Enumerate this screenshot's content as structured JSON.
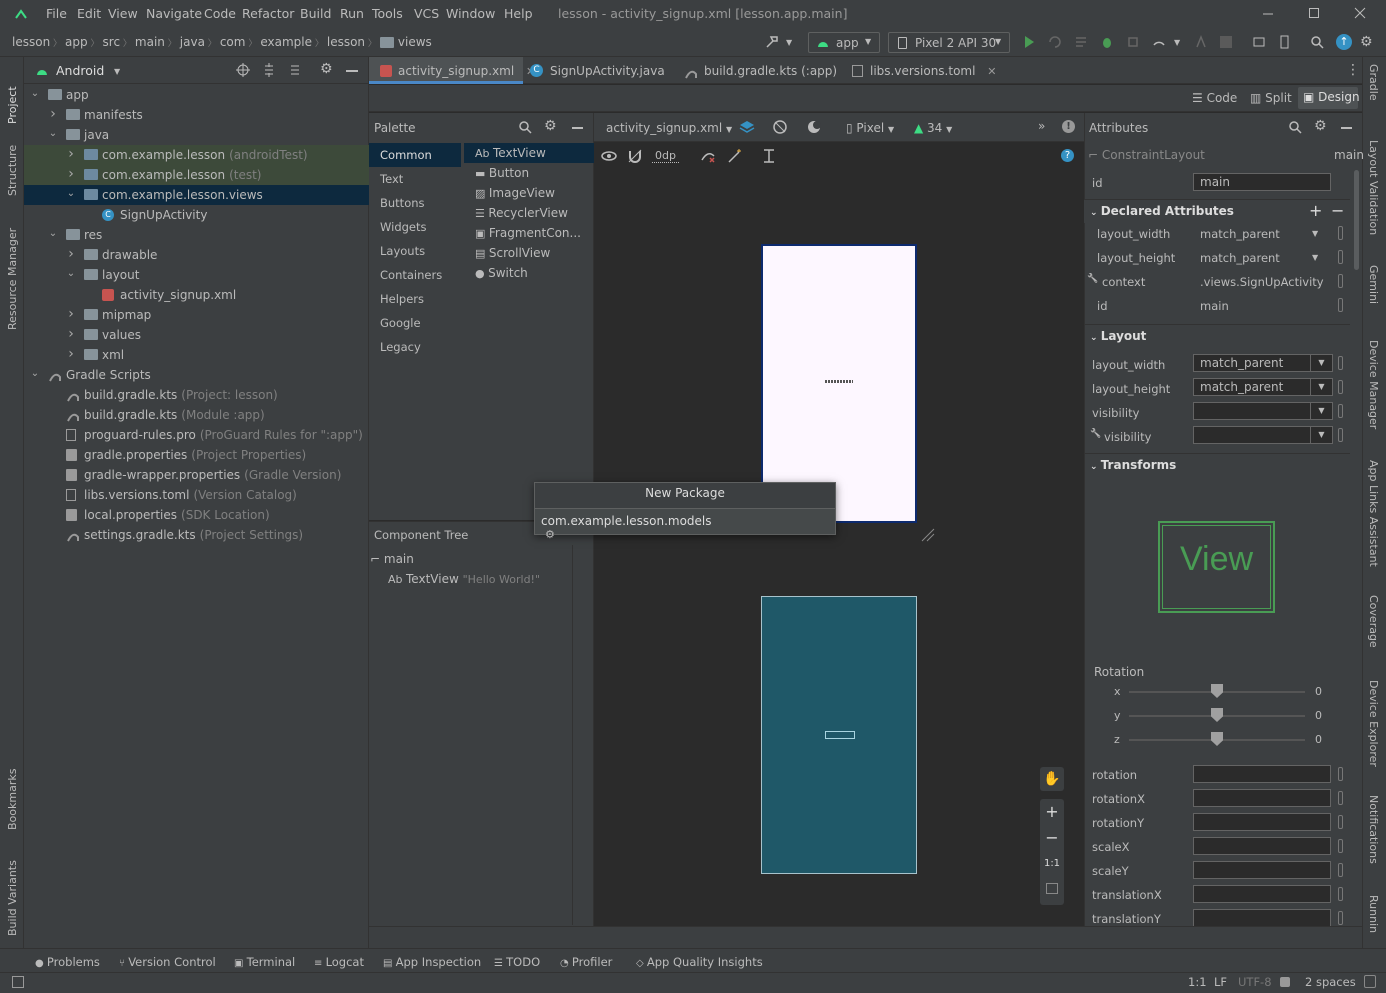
{
  "menu": {
    "items": [
      "File",
      "Edit",
      "View",
      "Navigate",
      "Code",
      "Refactor",
      "Build",
      "Run",
      "Tools",
      "VCS",
      "Window",
      "Help"
    ],
    "window_title": "lesson - activity_signup.xml [lesson.app.main]"
  },
  "breadcrumb": [
    "lesson",
    "app",
    "src",
    "main",
    "java",
    "com",
    "example",
    "lesson",
    "views"
  ],
  "toolbar": {
    "run_config": "app",
    "device": "Pixel 2 API 30"
  },
  "project_panel": {
    "title": "Android",
    "tree": [
      {
        "label": "app",
        "hint": ""
      },
      {
        "label": "manifests",
        "hint": ""
      },
      {
        "label": "java",
        "hint": ""
      },
      {
        "label": "com.example.lesson",
        "hint": "(androidTest)"
      },
      {
        "label": "com.example.lesson",
        "hint": "(test)"
      },
      {
        "label": "com.example.lesson.views",
        "hint": ""
      },
      {
        "label": "SignUpActivity",
        "hint": ""
      },
      {
        "label": "res",
        "hint": ""
      },
      {
        "label": "drawable",
        "hint": ""
      },
      {
        "label": "layout",
        "hint": ""
      },
      {
        "label": "activity_signup.xml",
        "hint": ""
      },
      {
        "label": "mipmap",
        "hint": ""
      },
      {
        "label": "values",
        "hint": ""
      },
      {
        "label": "xml",
        "hint": ""
      },
      {
        "label": "Gradle Scripts",
        "hint": ""
      },
      {
        "label": "build.gradle.kts",
        "hint": "(Project: lesson)"
      },
      {
        "label": "build.gradle.kts",
        "hint": "(Module :app)"
      },
      {
        "label": "proguard-rules.pro",
        "hint": "(ProGuard Rules for \":app\")"
      },
      {
        "label": "gradle.properties",
        "hint": "(Project Properties)"
      },
      {
        "label": "gradle-wrapper.properties",
        "hint": "(Gradle Version)"
      },
      {
        "label": "libs.versions.toml",
        "hint": "(Version Catalog)"
      },
      {
        "label": "local.properties",
        "hint": "(SDK Location)"
      },
      {
        "label": "settings.gradle.kts",
        "hint": "(Project Settings)"
      }
    ]
  },
  "left_strip": [
    "Project",
    "Structure",
    "Resource Manager",
    "Bookmarks",
    "Build Variants"
  ],
  "right_strip": [
    "Gradle",
    "Layout Validation",
    "Gemini",
    "Device Manager",
    "App Links Assistant",
    "Coverage",
    "Device Explorer",
    "Notifications",
    "Runnin"
  ],
  "editor_tabs": [
    "activity_signup.xml",
    "SignUpActivity.java",
    "build.gradle.kts (:app)",
    "libs.versions.toml"
  ],
  "view_modes": [
    "Code",
    "Split",
    "Design"
  ],
  "palette": {
    "title": "Palette",
    "categories": [
      "Common",
      "Text",
      "Buttons",
      "Widgets",
      "Layouts",
      "Containers",
      "Helpers",
      "Google",
      "Legacy"
    ],
    "widgets": [
      "TextView",
      "Button",
      "ImageView",
      "RecyclerView",
      "FragmentCon...",
      "ScrollView",
      "Switch"
    ]
  },
  "design_toolbar": {
    "file": "activity_signup.xml",
    "device": "Pixel",
    "api": "34",
    "margin": "0dp"
  },
  "component_tree": {
    "title": "Component Tree",
    "root": "main",
    "child": "TextView",
    "child_hint": "\"Hello World!\""
  },
  "popup": {
    "title": "New Package",
    "value": "com.example.lesson.models"
  },
  "attributes": {
    "title": "Attributes",
    "component": "ConstraintLayout",
    "component_id": "main",
    "id_label": "id",
    "id_value": "main",
    "declared_title": "Declared Attributes",
    "declared": [
      {
        "name": "layout_width",
        "value": "match_parent"
      },
      {
        "name": "layout_height",
        "value": "match_parent"
      },
      {
        "name": "context",
        "value": ".views.SignUpActivity"
      },
      {
        "name": "id",
        "value": "main"
      }
    ],
    "layout_title": "Layout",
    "layout": [
      {
        "name": "layout_width",
        "value": "match_parent"
      },
      {
        "name": "layout_height",
        "value": "match_parent"
      },
      {
        "name": "visibility",
        "value": ""
      },
      {
        "name": "visibility",
        "value": ""
      }
    ],
    "transforms_title": "Transforms",
    "preview_text": "View",
    "rotation_title": "Rotation",
    "rotation_axes": [
      {
        "axis": "x",
        "value": "0"
      },
      {
        "axis": "y",
        "value": "0"
      },
      {
        "axis": "z",
        "value": "0"
      }
    ],
    "transform_fields": [
      "rotation",
      "rotationX",
      "rotationY",
      "scaleX",
      "scaleY",
      "translationX",
      "translationY"
    ]
  },
  "bottom_tabs": [
    "Problems",
    "Version Control",
    "Terminal",
    "Logcat",
    "App Inspection",
    "TODO",
    "Profiler",
    "App Quality Insights"
  ],
  "status": {
    "position": "1:1",
    "line_sep": "LF",
    "encoding": "UTF-8",
    "indent": "2 spaces"
  },
  "zoom_label": "1:1",
  "colors": {
    "accent": "#3592c4",
    "selection": "#0d293e",
    "test_bg": "#3d4a3a",
    "blueprint": "#1f5868",
    "view_green": "#499c54"
  }
}
